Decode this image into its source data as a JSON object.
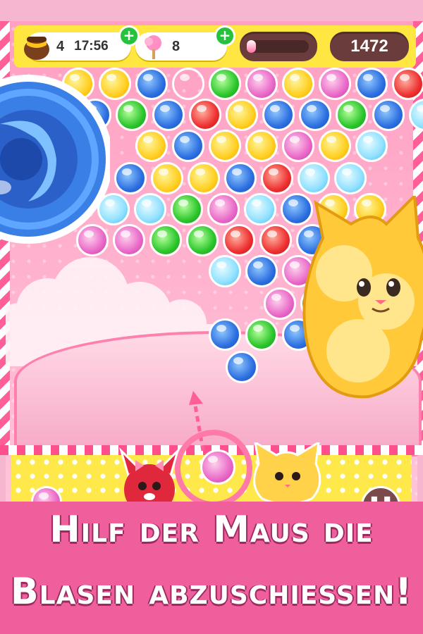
{
  "hud": {
    "honey_count": "4",
    "timer": "17:56",
    "candy_count": "8",
    "score": "1472",
    "progress": 0.15
  },
  "icons": {
    "honey_pot": "honey-pot-icon",
    "cotton_candy": "cotton-candy-icon",
    "add": "plus-icon",
    "pause": "pause-icon"
  },
  "caption": {
    "line1": "Hilf der Maus die",
    "line2": "Blasen abzuschiessen!"
  },
  "colors": {
    "banner": "#ee5f9c",
    "hud_bar": "#ffe640",
    "score_pill": "#6b3c3c"
  }
}
